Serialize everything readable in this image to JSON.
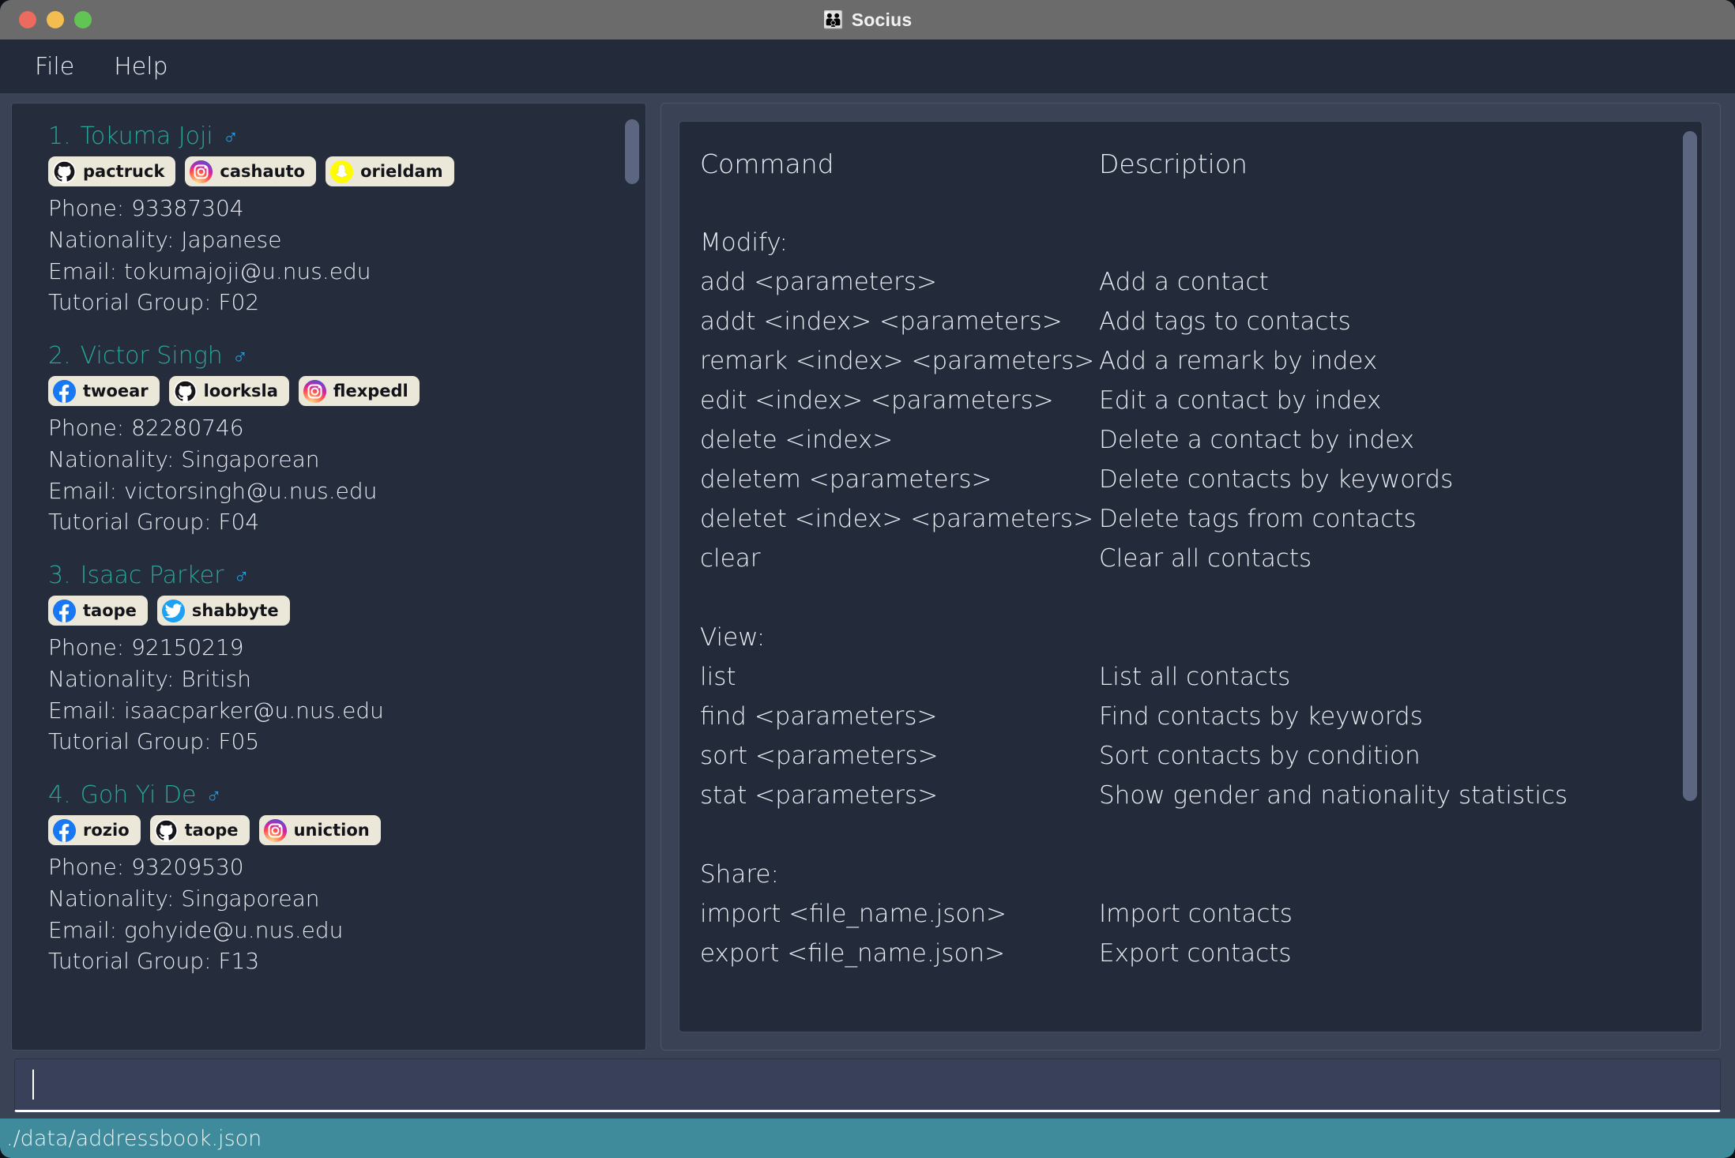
{
  "window": {
    "title": "Socius",
    "title_icon": "people-icon",
    "traffic_lights": [
      "close",
      "minimize",
      "maximize"
    ]
  },
  "menubar": {
    "items": [
      {
        "label": "File"
      },
      {
        "label": "Help"
      }
    ]
  },
  "person_list": {
    "people": [
      {
        "index": "1.",
        "name": "Tokuma Joji",
        "gender_icon": "male-symbol",
        "tags": [
          {
            "platform": "github",
            "handle": "pactruck"
          },
          {
            "platform": "instagram",
            "handle": "cashauto"
          },
          {
            "platform": "snapchat",
            "handle": "orieldam"
          }
        ],
        "phone": "Phone: 93387304",
        "nationality": "Nationality: Japanese",
        "email": "Email: tokumajoji@u.nus.edu",
        "tutorial_group": "Tutorial Group: F02"
      },
      {
        "index": "2.",
        "name": "Victor Singh",
        "gender_icon": "male-symbol",
        "tags": [
          {
            "platform": "facebook",
            "handle": "twoear"
          },
          {
            "platform": "github",
            "handle": "loorksla"
          },
          {
            "platform": "instagram",
            "handle": "flexpedl"
          }
        ],
        "phone": "Phone: 82280746",
        "nationality": "Nationality: Singaporean",
        "email": "Email: victorsingh@u.nus.edu",
        "tutorial_group": "Tutorial Group: F04"
      },
      {
        "index": "3.",
        "name": "Isaac Parker",
        "gender_icon": "male-symbol",
        "tags": [
          {
            "platform": "facebook",
            "handle": "taope"
          },
          {
            "platform": "twitter",
            "handle": "shabbyte"
          }
        ],
        "phone": "Phone: 92150219",
        "nationality": "Nationality: British",
        "email": "Email: isaacparker@u.nus.edu",
        "tutorial_group": "Tutorial Group: F05"
      },
      {
        "index": "4.",
        "name": "Goh Yi De",
        "gender_icon": "male-symbol",
        "tags": [
          {
            "platform": "facebook",
            "handle": "rozio"
          },
          {
            "platform": "github",
            "handle": "taope"
          },
          {
            "platform": "instagram",
            "handle": "uniction"
          }
        ],
        "phone": "Phone: 93209530",
        "nationality": "Nationality: Singaporean",
        "email": "Email: gohyide@u.nus.edu",
        "tutorial_group": "Tutorial Group: F13"
      }
    ]
  },
  "help_panel": {
    "header": {
      "command": "Command",
      "description": "Description"
    },
    "sections": [
      {
        "title": "Modify:",
        "rows": [
          {
            "command": "add <parameters>",
            "description": "Add a contact"
          },
          {
            "command": "addt <index> <parameters>",
            "description": "Add tags to contacts"
          },
          {
            "command": "remark <index> <parameters>",
            "description": "Add a remark by index"
          },
          {
            "command": "edit <index> <parameters>",
            "description": "Edit a contact by index"
          },
          {
            "command": "delete <index>",
            "description": "Delete a contact by index"
          },
          {
            "command": "deletem <parameters>",
            "description": "Delete contacts by keywords"
          },
          {
            "command": "deletet <index> <parameters>",
            "description": "Delete tags from contacts"
          },
          {
            "command": "clear",
            "description": "Clear all contacts"
          }
        ]
      },
      {
        "title": "View:",
        "rows": [
          {
            "command": "list",
            "description": "List all contacts"
          },
          {
            "command": "find <parameters>",
            "description": "Find contacts by keywords"
          },
          {
            "command": "sort <parameters>",
            "description": "Sort contacts by condition"
          },
          {
            "command": "stat <parameters>",
            "description": "Show gender and nationality statistics"
          }
        ]
      },
      {
        "title": "Share:",
        "rows": [
          {
            "command": "import <file_name.json>",
            "description": "Import contacts"
          },
          {
            "command": "export <file_name.json>",
            "description": "Export contacts"
          }
        ]
      }
    ]
  },
  "command_input": {
    "value": "",
    "placeholder": ""
  },
  "statusbar": {
    "path": "./data/addressbook.json"
  },
  "colors": {
    "accent_teal": "#26a699",
    "gender_blue": "#2e9ddb",
    "status_bar": "#3f8a9b",
    "panel_dark": "#232b3b",
    "panel_slate": "#3a4255",
    "chip_bg": "#ece8d9"
  }
}
